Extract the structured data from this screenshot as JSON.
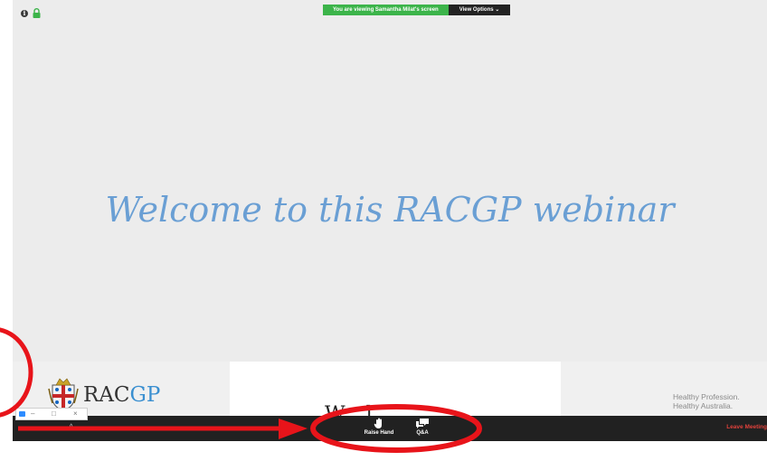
{
  "banner": {
    "sharing_text": "You are viewing Samantha Milat's screen",
    "view_options_label": "View Options ⌄"
  },
  "slide": {
    "welcome_text": "Welcome to this RACGP webinar",
    "logo_text_rac": "RAC",
    "logo_text_gp": "GP",
    "tagline_line1": "Healthy Profession.",
    "tagline_line2": "Healthy Australia.",
    "cut_off_text": "W   l"
  },
  "toolbar": {
    "raise_hand_label": "Raise Hand",
    "qa_label": "Q&A",
    "leave_label": "Leave Meeting"
  },
  "mini_window": {
    "minimize_glyph": "–",
    "restore_glyph": "□",
    "close_glyph": "×"
  },
  "icons": {
    "info": "i",
    "caret": "^"
  },
  "colors": {
    "banner_green": "#3cb44a",
    "welcome_blue": "#6a9fd4",
    "toolbar_bg": "#212121",
    "leave_red": "#e0413b",
    "annotation_red": "#e8141a"
  }
}
